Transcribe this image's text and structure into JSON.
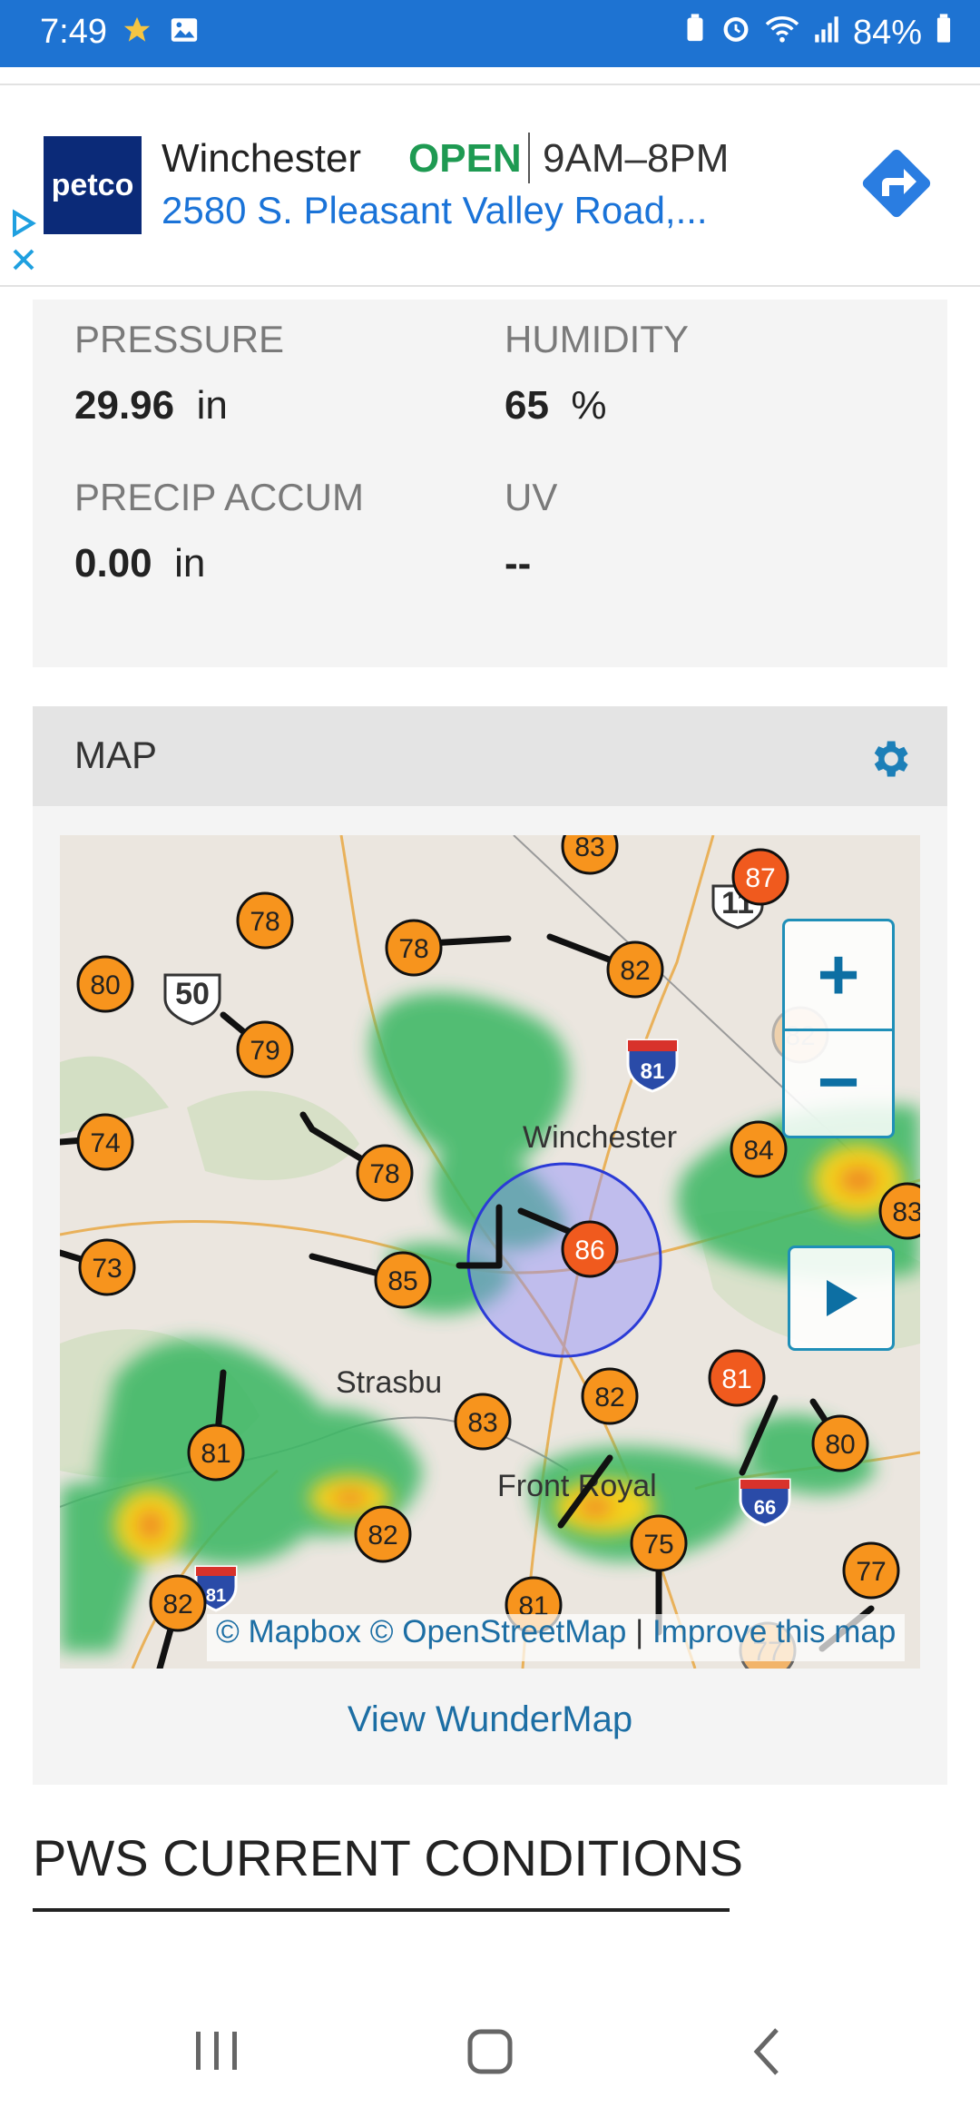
{
  "status_bar": {
    "time": "7:49",
    "battery": "84%"
  },
  "ad": {
    "logo_text": "petco",
    "store_name": "Winchester",
    "status": "OPEN",
    "hours": "9AM–8PM",
    "address": "2580 S. Pleasant Valley Road,...",
    "colors": {
      "open": "#1e9a52",
      "address": "#1a73d8",
      "directions": "#2a7de1"
    }
  },
  "conditions": {
    "pressure": {
      "label": "PRESSURE",
      "value": "29.96",
      "unit": "in"
    },
    "humidity": {
      "label": "HUMIDITY",
      "value": "65",
      "unit": "%"
    },
    "precip": {
      "label": "PRECIP ACCUM",
      "value": "0.00",
      "unit": "in"
    },
    "uv": {
      "label": "UV",
      "value": "--"
    }
  },
  "map_section": {
    "title": "MAP",
    "place_labels": {
      "winchester": "Winchester",
      "strasburg": "Strasbu",
      "front_royal": "Front Royal"
    },
    "route_shields": {
      "us50": "50",
      "i81": "81",
      "i66": "66",
      "us11": "11",
      "i81b": "81"
    },
    "stations": [
      "83",
      "87",
      "78",
      "78",
      "82",
      "80",
      "79",
      "74",
      "82",
      "78",
      "84",
      "83",
      "73",
      "86",
      "85",
      "81",
      "80",
      "81",
      "82",
      "83",
      "75",
      "82",
      "77",
      "82",
      "81",
      "77"
    ],
    "attribution": {
      "mapbox": "© Mapbox",
      "osm": "© OpenStreetMap",
      "improve": "Improve this map"
    },
    "view_link": "View WunderMap",
    "colors": {
      "station_orange": "#f7941d",
      "station_red": "#f05a1e",
      "radar_green": "#3db865",
      "radar_yellow": "#f3d21b",
      "control_blue": "#0d6fa3"
    }
  },
  "pws": {
    "heading": "PWS CURRENT CONDITIONS"
  }
}
